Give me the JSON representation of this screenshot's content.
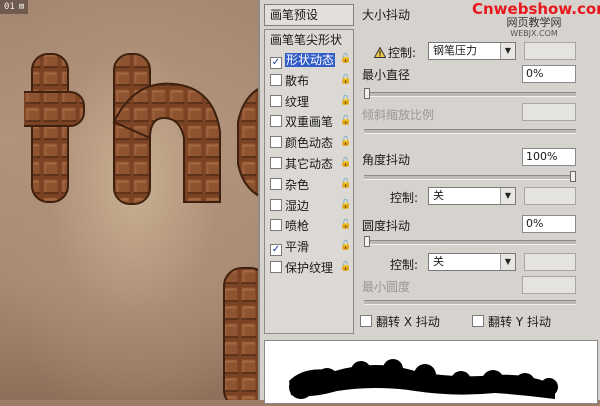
{
  "canvas": {
    "tab_label": "01",
    "tab_icon": "image-window-icon",
    "text_letters": [
      "t",
      "h",
      "e",
      "i"
    ]
  },
  "panel": {
    "preset_header": "画笔预设",
    "options": [
      {
        "label": "画笔笔尖形状",
        "type": "tip"
      },
      {
        "label": "形状动态",
        "checked": true,
        "selected": true,
        "locked": true
      },
      {
        "label": "散布",
        "checked": false,
        "locked": true
      },
      {
        "label": "纹理",
        "checked": false,
        "locked": true
      },
      {
        "label": "双重画笔",
        "checked": false,
        "locked": true
      },
      {
        "label": "颜色动态",
        "checked": false,
        "locked": true
      },
      {
        "label": "其它动态",
        "checked": false,
        "locked": true
      },
      {
        "label": "杂色",
        "checked": false,
        "locked": true
      },
      {
        "label": "湿边",
        "checked": false,
        "locked": true
      },
      {
        "label": "喷枪",
        "checked": false,
        "locked": true
      },
      {
        "label": "平滑",
        "checked": true,
        "locked": true
      },
      {
        "label": "保护纹理",
        "checked": false,
        "locked": true
      }
    ],
    "size_jitter": {
      "label": "大小抖动",
      "value": ""
    },
    "size_control": {
      "label": "控制:",
      "value": "钢笔压力",
      "warning_icon": "warning-triangle-icon",
      "extra": ""
    },
    "min_diameter": {
      "label": "最小直径",
      "value": "0%",
      "slider": 0
    },
    "tilt_scale": {
      "label": "倾斜缩放比例",
      "value": ""
    },
    "angle_jitter": {
      "label": "角度抖动",
      "value": "100%",
      "slider": 1
    },
    "angle_control": {
      "label": "控制:",
      "value": "关",
      "extra": ""
    },
    "roundness_jitter": {
      "label": "圆度抖动",
      "value": "0%",
      "slider": 0
    },
    "roundness_control": {
      "label": "控制:",
      "value": "关",
      "extra": ""
    },
    "min_roundness": {
      "label": "最小圆度",
      "value": ""
    },
    "flip_x": {
      "label": "翻转 X 抖动",
      "checked": false
    },
    "flip_y": {
      "label": "翻转 Y 抖动",
      "checked": false
    }
  },
  "watermark": {
    "main": "Cnwebshow.com",
    "sub": "网页教学网",
    "sub2": "WEBJX.COM"
  }
}
